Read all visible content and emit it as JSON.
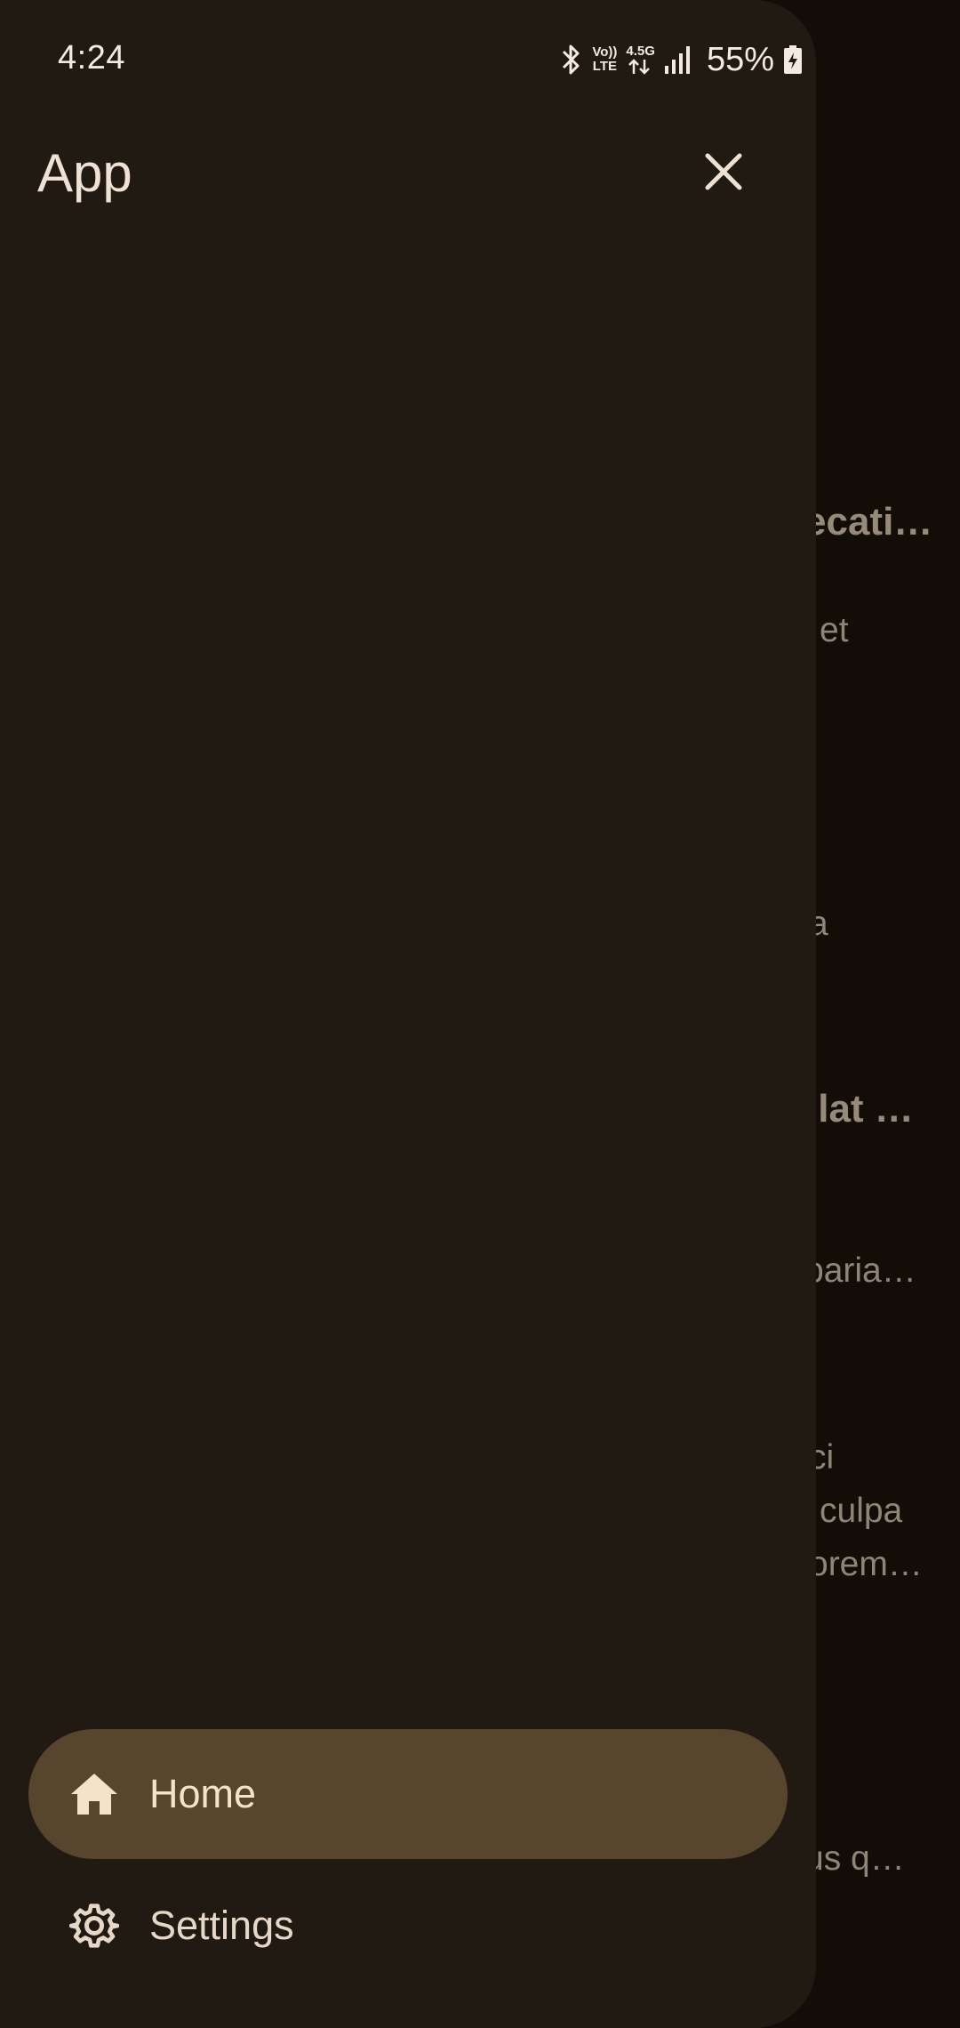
{
  "status_bar": {
    "time": "4:24",
    "icons": [
      "bluetooth-icon",
      "volte-icon",
      "4.5g-data-icon",
      "signal-icon",
      "battery-charging-icon"
    ],
    "volte_top": "Vo))",
    "volte_bottom": "LTE",
    "network_label": "4.5G",
    "battery": "55%"
  },
  "drawer": {
    "title": "App",
    "close_icon": "close-icon",
    "items": [
      {
        "label": "Home",
        "icon": "home-icon",
        "selected": true
      },
      {
        "label": "Settings",
        "icon": "gear-icon",
        "selected": false
      }
    ]
  },
  "background": {
    "visible_fragments": [
      "ecati…",
      "et",
      "a",
      "llat …",
      "paria…",
      "ci",
      "culpa",
      "orem…",
      "us q…"
    ]
  },
  "colors": {
    "drawer_bg": "#211a13",
    "selected_item_bg": "#57452d",
    "scrim_bg": "#120d07",
    "text_primary": "#efe1d3"
  }
}
